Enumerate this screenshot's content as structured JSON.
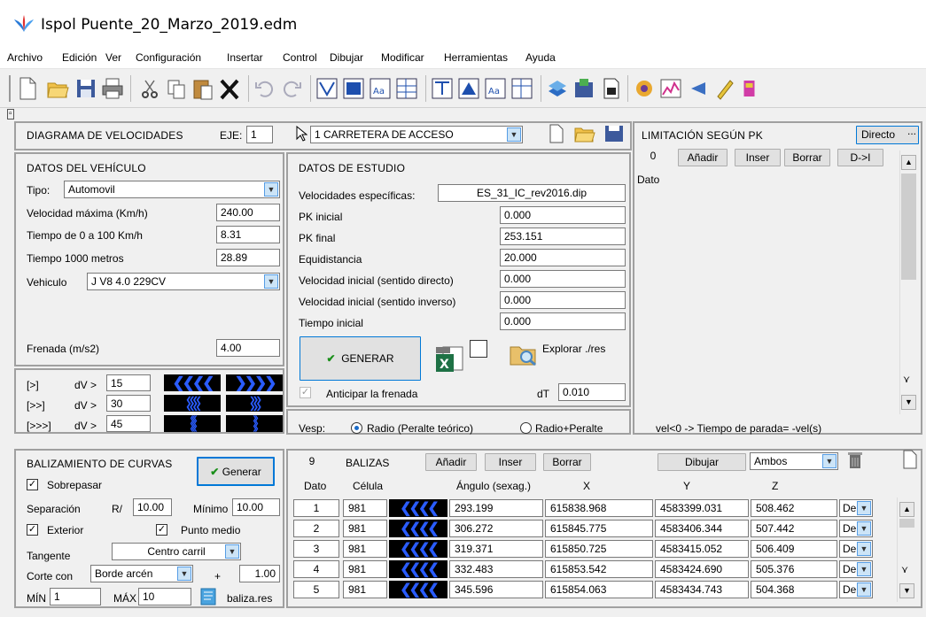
{
  "window": {
    "title": "Ispol Puente_20_Marzo_2019.edm"
  },
  "menu": [
    "Archivo",
    "Edición",
    "Ver",
    "Configuración",
    "Insertar",
    "Control",
    "Dibujar",
    "Modificar",
    "Herramientas",
    "Ayuda"
  ],
  "diagram": {
    "title": "DIAGRAMA DE VELOCIDADES",
    "eje_label": "EJE:",
    "eje_value": "1",
    "axis_name": "1 CARRETERA DE ACCESO"
  },
  "vehicle": {
    "title": "DATOS DEL VEHÍCULO",
    "tipo_label": "Tipo:",
    "tipo_value": "Automovil",
    "vmax_label": "Velocidad máxima (Km/h)",
    "vmax_value": "240.00",
    "t100_label": "Tiempo de 0 a 100 Km/h",
    "t100_value": "8.31",
    "t1000_label": "Tiempo 1000 metros",
    "t1000_value": "28.89",
    "veh_label": "Vehiculo",
    "veh_value": "J V8 4.0 229CV",
    "frenada_label": "Frenada (m/s2)",
    "frenada_value": "4.00"
  },
  "dv": {
    "rows": [
      {
        "tag": "[>]",
        "label": "dV >",
        "value": "15"
      },
      {
        "tag": "[>>]",
        "label": "dV >",
        "value": "30"
      },
      {
        "tag": "[>>>]",
        "label": "dV >",
        "value": "45"
      }
    ]
  },
  "study": {
    "title": "DATOS DE ESTUDIO",
    "vel_esp_label": "Velocidades específicas:",
    "vel_esp_value": "ES_31_IC_rev2016.dip",
    "fields": [
      {
        "label": "PK inicial",
        "value": "0.000"
      },
      {
        "label": "PK final",
        "value": "253.151"
      },
      {
        "label": "Equidistancia",
        "value": "20.000"
      },
      {
        "label": "Velocidad inicial (sentido directo)",
        "value": "0.000"
      },
      {
        "label": "Velocidad inicial (sentido inverso)",
        "value": "0.000"
      },
      {
        "label": "Tiempo inicial",
        "value": "0.000"
      }
    ],
    "generar": "GENERAR",
    "explorar": "Explorar ./res",
    "anticipar": "Anticipar la frenada",
    "dt_label": "dT",
    "dt_value": "0.010"
  },
  "vesp": {
    "label": "Vesp:",
    "opt1": "Radio (Peralte teórico)",
    "opt2": "Radio+Peralte"
  },
  "limit": {
    "title": "LIMITACIÓN SEGÚN PK",
    "directo": "Directo",
    "count": "0",
    "anadir": "Añadir",
    "inser": "Inser",
    "borrar": "Borrar",
    "dtoi": "D->I",
    "dato": "Dato",
    "footer": "vel<0 -> Tiempo de parada= -vel(s)"
  },
  "curves": {
    "title": "BALIZAMIENTO DE CURVAS",
    "generar": "Generar",
    "sobrepasar": "Sobrepasar",
    "sep_label": "Separación",
    "r_label": "R/",
    "r_value": "10.00",
    "min_label": "Mínimo",
    "min_value": "10.00",
    "exterior": "Exterior",
    "punto_medio": "Punto medio",
    "tangente_label": "Tangente",
    "tangente_value": "Centro carril",
    "corte_label": "Corte con",
    "corte_value": "Borde arcén",
    "plus": "+",
    "corte_num": "1.00",
    "min2_label": "MÍN",
    "min2_value": "1",
    "max_label": "MÁX",
    "max_value": "10",
    "file": "baliza.res"
  },
  "balizas": {
    "count": "9",
    "title": "BALIZAS",
    "anadir": "Añadir",
    "inser": "Inser",
    "borrar": "Borrar",
    "dibujar": "Dibujar",
    "ambos": "Ambos",
    "headers": [
      "Dato",
      "Célula",
      "Ángulo (sexag.)",
      "X",
      "Y",
      "Z"
    ],
    "rows": [
      {
        "n": "1",
        "cel": "981",
        "ang": "293.199",
        "x": "615838.968",
        "y": "4583399.031",
        "z": "508.462",
        "side": "Der"
      },
      {
        "n": "2",
        "cel": "981",
        "ang": "306.272",
        "x": "615845.775",
        "y": "4583406.344",
        "z": "507.442",
        "side": "Der"
      },
      {
        "n": "3",
        "cel": "981",
        "ang": "319.371",
        "x": "615850.725",
        "y": "4583415.052",
        "z": "506.409",
        "side": "Der"
      },
      {
        "n": "4",
        "cel": "981",
        "ang": "332.483",
        "x": "615853.542",
        "y": "4583424.690",
        "z": "505.376",
        "side": "Der"
      },
      {
        "n": "5",
        "cel": "981",
        "ang": "345.596",
        "x": "615854.063",
        "y": "4583434.743",
        "z": "504.368",
        "side": "Der"
      }
    ]
  }
}
